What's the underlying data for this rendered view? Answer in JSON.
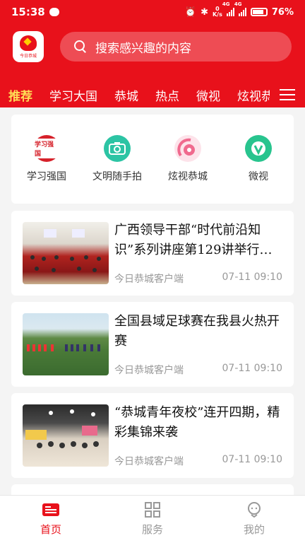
{
  "status_bar": {
    "time": "15:38",
    "net_speed_top": "0",
    "net_speed_bottom": "K/s",
    "net_type_1": "4G",
    "net_type_2": "4G",
    "battery": "76%"
  },
  "header": {
    "logo_text": "今日恭城",
    "search_placeholder": "搜索感兴趣的内容"
  },
  "tabs": [
    "推荐",
    "学习大国",
    "恭城",
    "热点",
    "微视",
    "炫视恭城"
  ],
  "active_tab": "推荐",
  "shortcuts": [
    {
      "label": "学习强国",
      "icon": "xuexi-qiangguo-icon",
      "badge": "学习强国",
      "color": "#d6212a"
    },
    {
      "label": "文明随手拍",
      "icon": "camera-icon",
      "color": "#2cc4a4"
    },
    {
      "label": "炫视恭城",
      "icon": "flower-icon",
      "color": "#f06a8e"
    },
    {
      "label": "微视",
      "icon": "v-icon",
      "color": "#28c48e"
    }
  ],
  "news": [
    {
      "title": "广西领导干部“时代前沿知识”系列讲座第129讲举行…",
      "source": "今日恭城客户端",
      "time": "07-11  09:10"
    },
    {
      "title": "全国县域足球赛在我县火热开赛",
      "source": "今日恭城客户端",
      "time": "07-11  09:10"
    },
    {
      "title": "“恭城青年夜校”连开四期，精彩集锦来袭",
      "source": "今日恭城客户端",
      "time": "07-11  09:10"
    }
  ],
  "bottom_nav": [
    {
      "label": "首页",
      "icon": "home-news-icon",
      "active": true
    },
    {
      "label": "服务",
      "icon": "grid-icon",
      "active": false
    },
    {
      "label": "我的",
      "icon": "profile-icon",
      "active": false
    }
  ],
  "colors": {
    "brand_red": "#e8111b",
    "tab_active": "#ffdd55"
  }
}
